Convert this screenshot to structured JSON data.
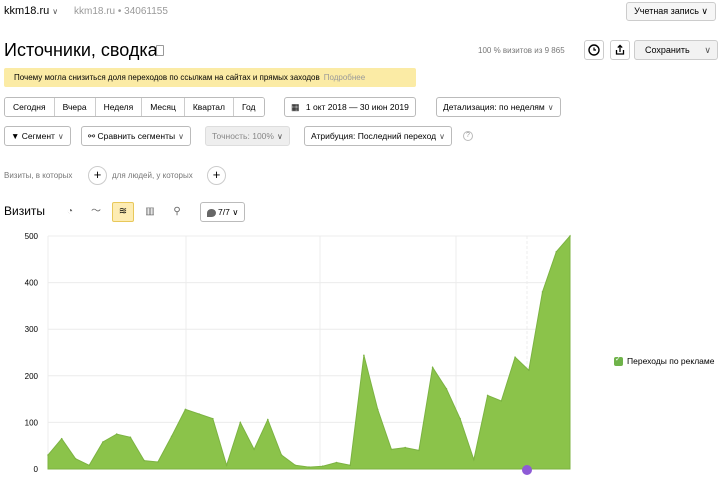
{
  "topbar": {
    "site": "kkm18.ru",
    "site_sub": "kkm18.ru • 34061155",
    "account": "Учетная запись"
  },
  "header": {
    "title": "Источники, сводка",
    "visits_share": "100 % визитов из 9 865",
    "save": "Сохранить"
  },
  "notice": {
    "text": "Почему могла снизиться доля переходов по ссылкам на сайтах и прямых заходов",
    "more": "Подробнее"
  },
  "periods": [
    "Сегодня",
    "Вчера",
    "Неделя",
    "Месяц",
    "Квартал",
    "Год"
  ],
  "date_range": "1 окт 2018 — 30 июн 2019",
  "detail": "Детализация: по неделям",
  "controls": {
    "segment": "Сегмент",
    "compare": "Сравнить сегменты",
    "accuracy": "Точность: 100%",
    "attribution": "Атрибуция: Последний переход"
  },
  "segment_builder": {
    "visits_where": "Визиты, в которых",
    "people_where": "для людей, у которых"
  },
  "chart_panel": {
    "title": "Визиты",
    "series_count": "7/7",
    "icons": [
      "pie-icon",
      "line-icon",
      "area-icon",
      "bar-icon",
      "map-icon"
    ]
  },
  "colors": {
    "series": "#8bc34a",
    "accent": "#fdecb3"
  },
  "chart_data": {
    "type": "area",
    "title": "",
    "xlabel": "",
    "ylabel": "",
    "ylim": [
      0,
      500
    ],
    "yticks": [
      0,
      100,
      200,
      300,
      400,
      500
    ],
    "series": [
      {
        "name": "Переходы по рекламе",
        "values": [
          30,
          65,
          22,
          8,
          58,
          75,
          68,
          18,
          15,
          70,
          128,
          118,
          108,
          8,
          100,
          42,
          106,
          30,
          8,
          4,
          6,
          14,
          8,
          244,
          128,
          42,
          46,
          40,
          218,
          172,
          108,
          20,
          158,
          146,
          240,
          212,
          380,
          466,
          500
        ]
      }
    ]
  }
}
